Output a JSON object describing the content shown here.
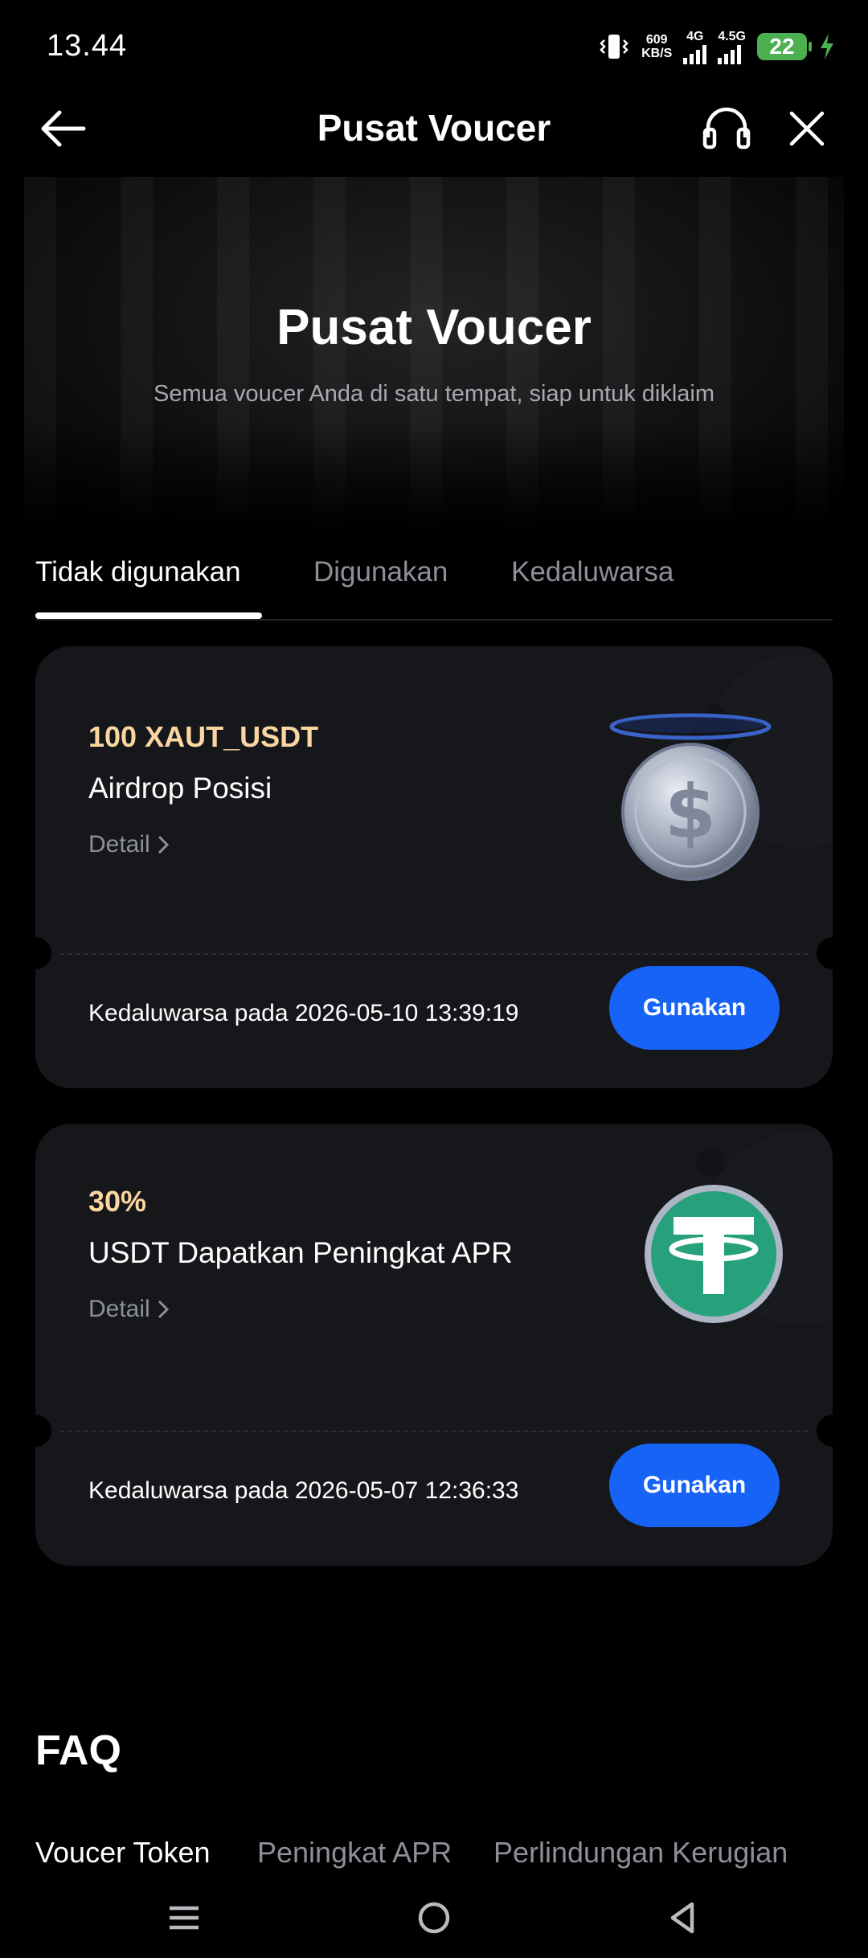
{
  "status_bar": {
    "time": "13.44",
    "net_speed_value": "609",
    "net_speed_unit": "KB/S",
    "signal1_label": "4G",
    "signal2_label": "4.5G",
    "battery": "22",
    "icons": [
      "vibrate-icon",
      "signal-icon",
      "charging-icon"
    ]
  },
  "header": {
    "title": "Pusat Voucer",
    "icons": [
      "back-arrow-icon",
      "headset-icon",
      "close-icon"
    ]
  },
  "hero": {
    "title": "Pusat Voucer",
    "subtitle": "Semua voucer Anda di satu tempat, siap untuk diklaim"
  },
  "tabs": [
    {
      "label": "Tidak digunakan",
      "active": true
    },
    {
      "label": "Digunakan",
      "active": false
    },
    {
      "label": "Kedaluwarsa",
      "active": false
    }
  ],
  "vouchers": [
    {
      "amount": "100 XAUT_USDT",
      "name": "Airdrop Posisi",
      "detail": "Detail",
      "expiry": "Kedaluwarsa pada 2026-05-10 13:39:19",
      "button": "Gunakan",
      "icon": "dollar-coin-icon"
    },
    {
      "amount": "30%",
      "name": "USDT Dapatkan Peningkat APR",
      "detail": "Detail",
      "expiry": "Kedaluwarsa pada 2026-05-07 12:36:33",
      "button": "Gunakan",
      "icon": "tether-coin-icon"
    }
  ],
  "faq": {
    "title": "FAQ",
    "tabs": [
      {
        "label": "Voucer Token",
        "active": true
      },
      {
        "label": "Peningkat APR",
        "active": false
      },
      {
        "label": "Perlindungan Kerugian",
        "active": false
      }
    ]
  },
  "nav_bar": {
    "icons": [
      "menu-icon",
      "home-circle-icon",
      "back-triangle-icon"
    ]
  },
  "colors": {
    "accent": "#1763f5",
    "amount_text": "#fbd6a0",
    "card_bg": "#16171b",
    "battery": "#4caf50"
  }
}
